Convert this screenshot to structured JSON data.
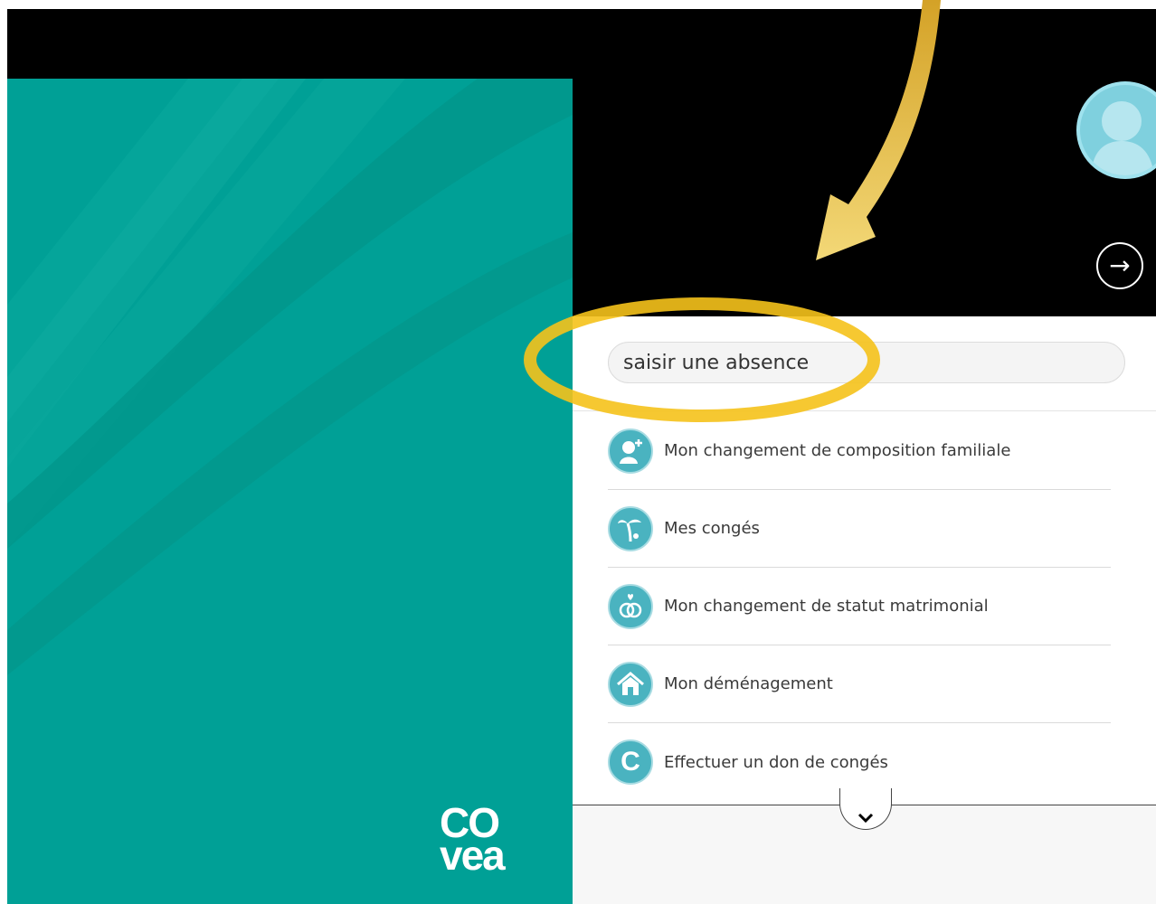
{
  "search": {
    "value": "saisir une absence",
    "placeholder": ""
  },
  "menu": {
    "items": [
      {
        "label": "Mon changement de composition familiale",
        "icon": "family-add-icon"
      },
      {
        "label": "Mes congés",
        "icon": "palm-tree-icon"
      },
      {
        "label": "Mon changement de statut matrimonial",
        "icon": "rings-icon"
      },
      {
        "label": "Mon déménagement",
        "icon": "house-icon"
      },
      {
        "label": "Effectuer un don de congés",
        "icon": "letter-c-icon",
        "glyph": "C"
      }
    ]
  },
  "logo": {
    "line1": "CO",
    "line2": "vea"
  },
  "colors": {
    "teal": "#00a096",
    "icon_bg": "#4ab3c0",
    "highlight": "#f5c21b"
  }
}
